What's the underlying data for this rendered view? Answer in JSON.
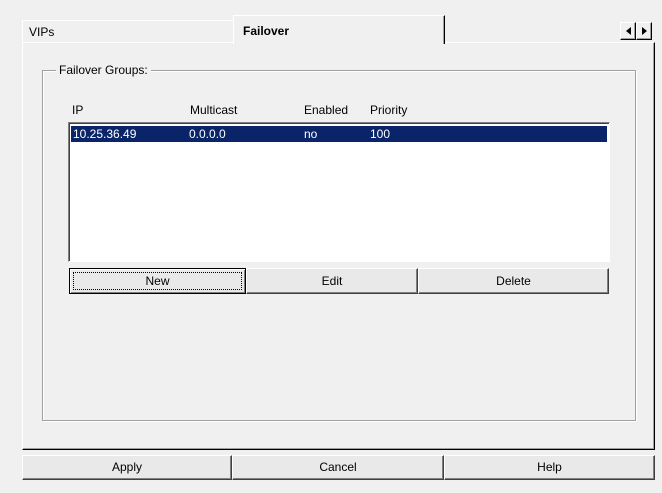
{
  "tabs": [
    {
      "label": "VIPs",
      "active": false
    },
    {
      "label": "Failover",
      "active": true
    }
  ],
  "group": {
    "label": "Failover Groups:",
    "columns": [
      "IP",
      "Multicast",
      "Enabled",
      "Priority"
    ],
    "rows": [
      {
        "ip": "10.25.36.49",
        "multicast": "0.0.0.0",
        "enabled": "no",
        "priority": "100",
        "selected": true
      }
    ],
    "buttons": {
      "new": "New",
      "edit": "Edit",
      "delete": "Delete"
    }
  },
  "footer": {
    "apply": "Apply",
    "cancel": "Cancel",
    "help": "Help"
  },
  "colors": {
    "selection": "#0a246a",
    "face": "#f0f0f0"
  }
}
